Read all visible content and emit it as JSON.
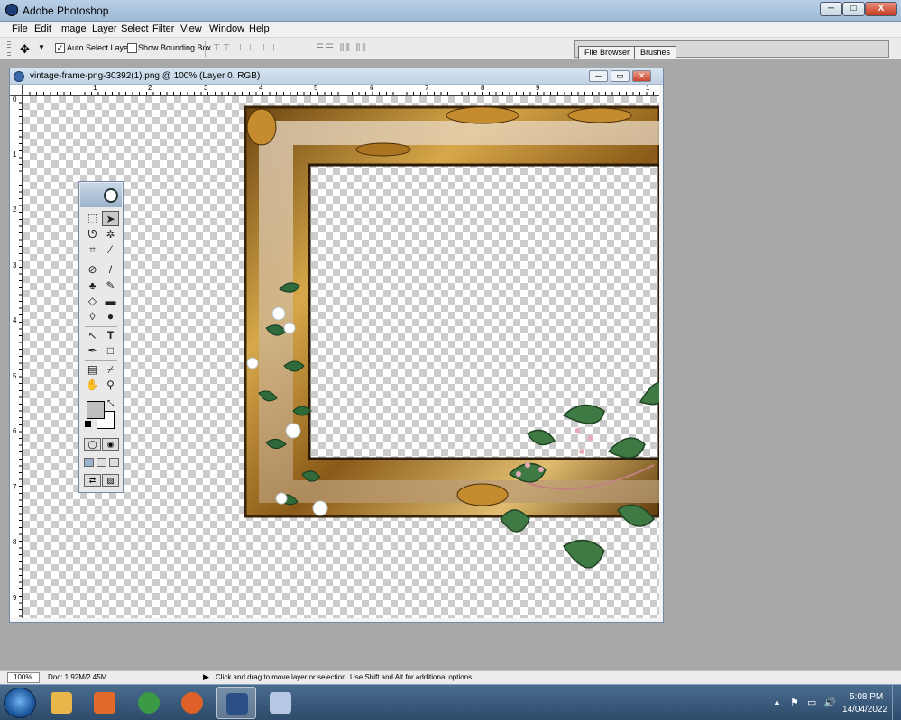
{
  "window": {
    "title": "Adobe Photoshop",
    "controls": {
      "minimize": "─",
      "maximize": "□",
      "close": "X"
    }
  },
  "menubar": [
    "File",
    "Edit",
    "Image",
    "Layer",
    "Select",
    "Filter",
    "View",
    "Window",
    "Help"
  ],
  "options_bar": {
    "auto_select_layer": {
      "label": "Auto Select Layer",
      "checked": true,
      "mark": "✓"
    },
    "show_bounding_box": {
      "label": "Show Bounding Box",
      "checked": false,
      "mark": ""
    },
    "align_icons_1": "⊤⊤ ⊥⊥ ⊥⊥",
    "align_icons_2": "☰☰ ⫼⫼ ⫼⫼",
    "palette_well_tabs": [
      "File Browser",
      "Brushes"
    ]
  },
  "document": {
    "title": "vintage-frame-png-30392(1).png @ 100% (Layer 0, RGB)",
    "ruler_top_labels": [
      "1",
      "2",
      "3",
      "4",
      "5",
      "6",
      "7",
      "8",
      "9",
      "1"
    ],
    "ruler_left_labels": [
      "0",
      "1",
      "2",
      "3",
      "4",
      "5",
      "6",
      "7",
      "8",
      "9"
    ]
  },
  "toolbox": {
    "tools": [
      {
        "name": "marquee-tool",
        "icon": "⬚"
      },
      {
        "name": "move-tool",
        "icon": "➤"
      },
      {
        "name": "lasso-tool",
        "icon": "ᘎ"
      },
      {
        "name": "magic-wand-tool",
        "icon": "✲"
      },
      {
        "name": "crop-tool",
        "icon": "⌗"
      },
      {
        "name": "slice-tool",
        "icon": "⁄"
      },
      {
        "name": "healing-brush-tool",
        "icon": "⊘"
      },
      {
        "name": "brush-tool",
        "icon": "/"
      },
      {
        "name": "clone-stamp-tool",
        "icon": "♣"
      },
      {
        "name": "history-brush-tool",
        "icon": "✎"
      },
      {
        "name": "eraser-tool",
        "icon": "◇"
      },
      {
        "name": "gradient-tool",
        "icon": "▬"
      },
      {
        "name": "blur-tool",
        "icon": "◊"
      },
      {
        "name": "dodge-tool",
        "icon": "●"
      },
      {
        "name": "path-selection-tool",
        "icon": "↖"
      },
      {
        "name": "type-tool",
        "icon": "T"
      },
      {
        "name": "pen-tool",
        "icon": "✒"
      },
      {
        "name": "shape-tool",
        "icon": "□"
      },
      {
        "name": "notes-tool",
        "icon": "▤"
      },
      {
        "name": "eyedropper-tool",
        "icon": "⌿"
      },
      {
        "name": "hand-tool",
        "icon": "✋"
      },
      {
        "name": "zoom-tool",
        "icon": "⚲"
      }
    ],
    "swap_icon": "⤡",
    "selected_tool": "move-tool"
  },
  "statusbar": {
    "zoom": "100%",
    "doc_size": "Doc: 1.92M/2.45M",
    "arrow": "▶",
    "message": "Click and drag to move layer or selection.  Use Shift and Alt for additional options."
  },
  "taskbar": {
    "apps": [
      {
        "name": "file-explorer",
        "color": "#e8b64a",
        "active": false
      },
      {
        "name": "media-player",
        "color": "#e36a2b",
        "active": false
      },
      {
        "name": "chrome",
        "color": "#3b9a45",
        "active": false
      },
      {
        "name": "firefox",
        "color": "#e0602a",
        "active": false
      },
      {
        "name": "photoshop",
        "color": "#2a4f86",
        "active": true
      },
      {
        "name": "paint",
        "color": "#b6c8e3",
        "active": false
      }
    ],
    "tray_up": "▲",
    "tray_icons": [
      "⚑",
      "▭",
      "🔊"
    ],
    "time": "5:08 PM",
    "date": "14/04/2022"
  },
  "colors": {
    "foreground": "#bebebe",
    "background": "#ffffff",
    "frame_gold": "#b6812a",
    "leaf_green": "#2f6b3a"
  }
}
